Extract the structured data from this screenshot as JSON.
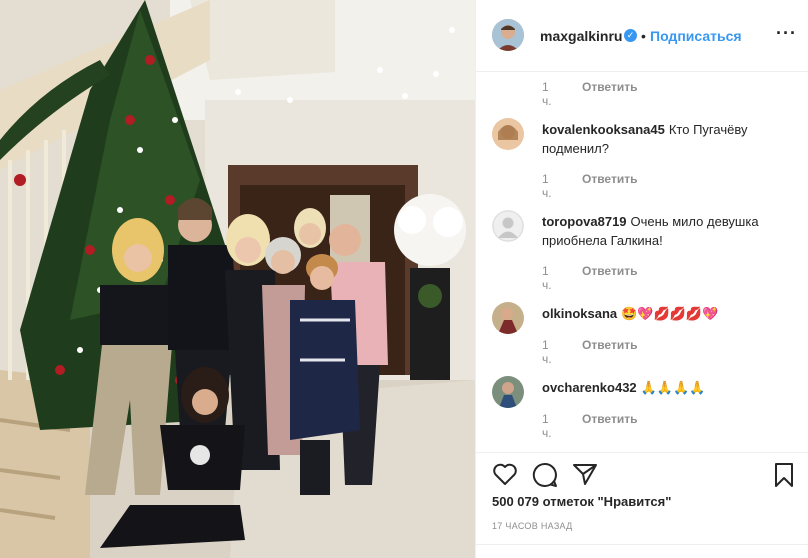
{
  "post": {
    "author": "maxgalkinru",
    "follow_label": "Подписаться",
    "separator": "•",
    "more_label": "···",
    "verified_mark": "✓"
  },
  "first_meta": {
    "time": "1 ч.",
    "reply": "Ответить"
  },
  "comments": [
    {
      "user": "kovalenkooksana45",
      "text": "Кто Пугачёву подменил?",
      "time": "1 ч.",
      "reply": "Ответить"
    },
    {
      "user": "toropova8719",
      "text": "Очень мило девушка приобнела Галкина!",
      "time": "1 ч.",
      "reply": "Ответить"
    },
    {
      "user": "olkinoksana",
      "text": "🤩💖💋💋💋💖",
      "time": "1 ч.",
      "reply": "Ответить"
    },
    {
      "user": "ovcharenko432",
      "text": "🙏🙏🙏🙏",
      "time": "1 ч.",
      "reply": "Ответить"
    }
  ],
  "likes_text": "500 079 отметок \"Нравится\"",
  "time_ago": "17 ЧАСОВ НАЗАД",
  "icons": [
    "heart-icon",
    "comment-icon",
    "share-icon",
    "bookmark-icon",
    "more-options-icon",
    "verified-badge-icon"
  ],
  "colors": {
    "link_blue": "#3897f0",
    "text": "#262626",
    "muted": "#8e8e8e",
    "border": "#efefef"
  }
}
